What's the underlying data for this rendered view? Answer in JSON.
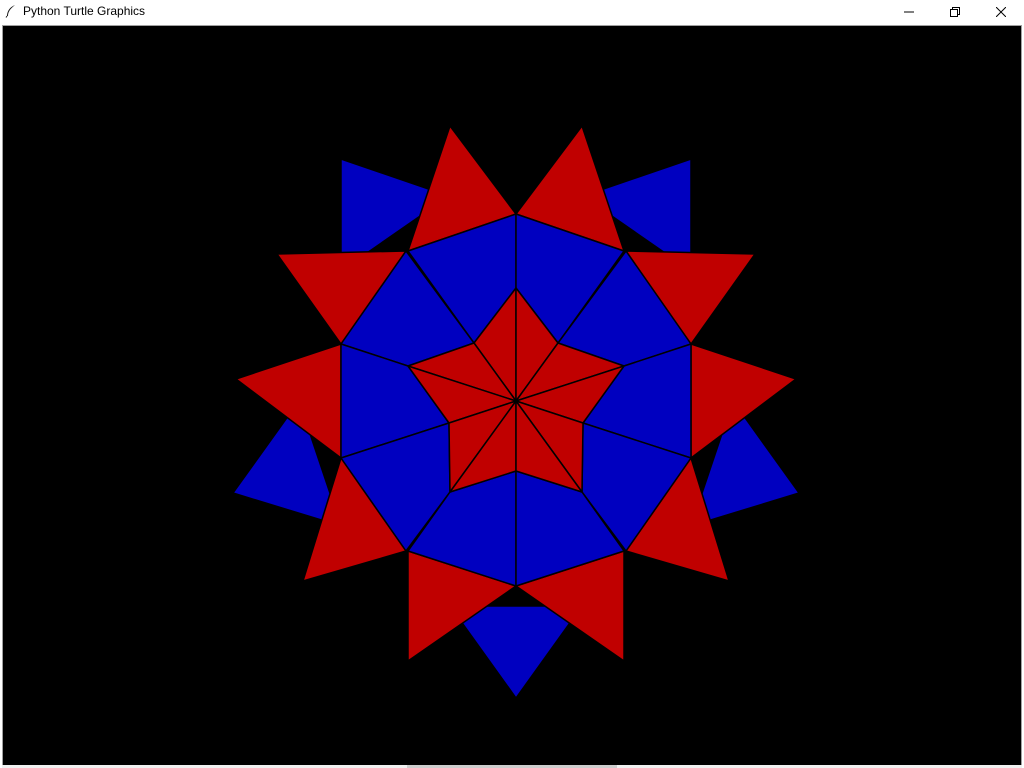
{
  "window": {
    "title": "Python Turtle Graphics",
    "icon": "feather-icon",
    "controls": [
      "minimize-icon",
      "restore-icon",
      "close-icon"
    ]
  },
  "canvas": {
    "background": "#000000",
    "fill_red": "#c00000",
    "fill_blue": "#0000c0",
    "outline": "#000000"
  }
}
